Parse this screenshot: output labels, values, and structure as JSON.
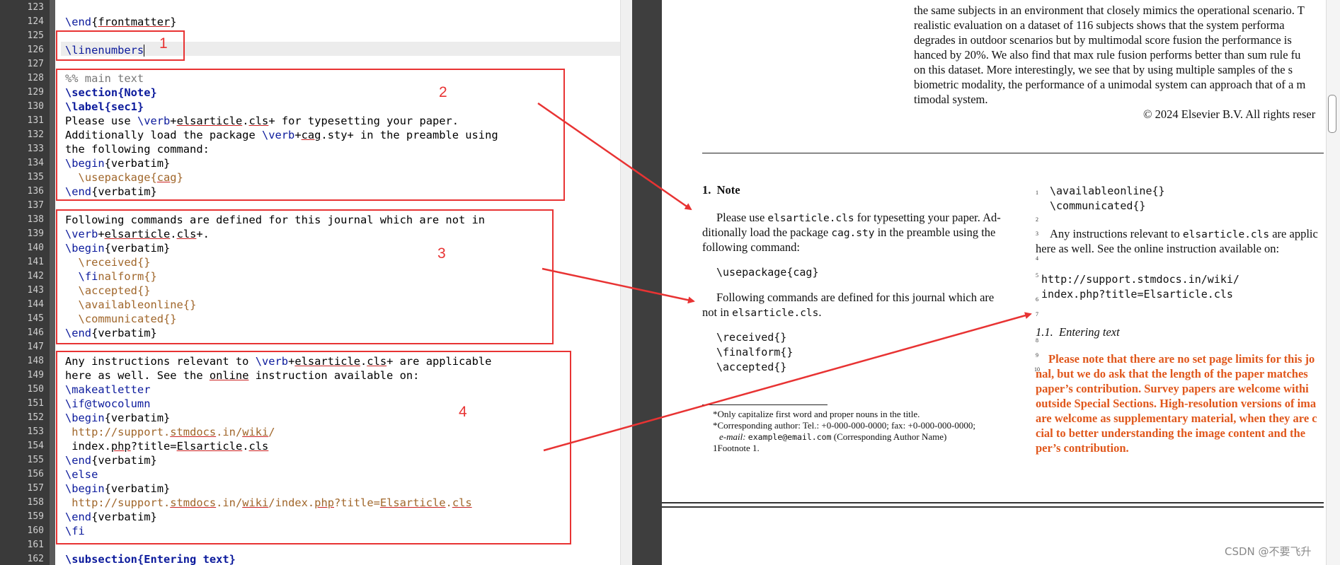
{
  "editor": {
    "lines": [
      {
        "no": "123",
        "code": ""
      },
      {
        "no": "124",
        "code": "\\end{frontmatter}"
      },
      {
        "no": "125",
        "code": ""
      },
      {
        "no": "126",
        "code": "\\linenumbers"
      },
      {
        "no": "127",
        "code": ""
      },
      {
        "no": "128",
        "code": "%% main text"
      },
      {
        "no": "129",
        "code": "\\section{Note}"
      },
      {
        "no": "130",
        "code": "\\label{sec1}"
      },
      {
        "no": "131",
        "code": "Please use \\verb+elsarticle.cls+ for typesetting your paper."
      },
      {
        "no": "132",
        "code": "Additionally load the package \\verb+cag.sty+ in the preamble using"
      },
      {
        "no": "133",
        "code": "the following command:"
      },
      {
        "no": "134",
        "code": "\\begin{verbatim}"
      },
      {
        "no": "135",
        "code": "  \\usepackage{cag}"
      },
      {
        "no": "136",
        "code": "\\end{verbatim}"
      },
      {
        "no": "137",
        "code": ""
      },
      {
        "no": "138",
        "code": "Following commands are defined for this journal which are not in"
      },
      {
        "no": "139",
        "code": "\\verb+elsarticle.cls+."
      },
      {
        "no": "140",
        "code": "\\begin{verbatim}"
      },
      {
        "no": "141",
        "code": "  \\received{}"
      },
      {
        "no": "142",
        "code": "  \\finalform{}"
      },
      {
        "no": "143",
        "code": "  \\accepted{}"
      },
      {
        "no": "144",
        "code": "  \\availableonline{}"
      },
      {
        "no": "145",
        "code": "  \\communicated{}"
      },
      {
        "no": "146",
        "code": "\\end{verbatim}"
      },
      {
        "no": "147",
        "code": ""
      },
      {
        "no": "148",
        "code": "Any instructions relevant to \\verb+elsarticle.cls+ are applicable"
      },
      {
        "no": "149",
        "code": "here as well. See the online instruction available on:"
      },
      {
        "no": "150",
        "code": "\\makeatletter"
      },
      {
        "no": "151",
        "code": "\\if@twocolumn"
      },
      {
        "no": "152",
        "code": "\\begin{verbatim}"
      },
      {
        "no": "153",
        "code": " http://support.stmdocs.in/wiki/"
      },
      {
        "no": "154",
        "code": " index.php?title=Elsarticle.cls"
      },
      {
        "no": "155",
        "code": "\\end{verbatim}"
      },
      {
        "no": "156",
        "code": "\\else"
      },
      {
        "no": "157",
        "code": "\\begin{verbatim}"
      },
      {
        "no": "158",
        "code": " http://support.stmdocs.in/wiki/index.php?title=Elsarticle.cls"
      },
      {
        "no": "159",
        "code": "\\end{verbatim}"
      },
      {
        "no": "160",
        "code": "\\fi"
      },
      {
        "no": "161",
        "code": ""
      },
      {
        "no": "162",
        "code": "\\subsection{Entering text}"
      }
    ]
  },
  "pdf": {
    "abstract_lines": [
      "the same subjects in an environment that closely mimics the operational scenario. T",
      "realistic evaluation on a dataset of 116 subjects shows that the system performa",
      "degrades in outdoor scenarios but by multimodal score fusion the performance is",
      "hanced by 20%. We also find that max rule fusion performs better than sum rule fu",
      "on this dataset. More interestingly, we see that by using multiple samples of the s",
      "biometric modality, the performance of a unimodal system can approach that of a m",
      "timodal system."
    ],
    "copyright": "© 2024 Elsevier B.V. All rights reser",
    "left_col": {
      "heading": "1.  Note",
      "p1": [
        "Please use ",
        "elsarticle.cls",
        " for typesetting your paper. Ad-"
      ],
      "p1_line2": [
        "ditionally load the package ",
        "cag.sty",
        " in the preamble using the"
      ],
      "p1_line3": "following command:",
      "usepackage": "\\usepackage{cag}",
      "p2_line1": "Following commands are defined for this journal which are",
      "p2_line2": [
        "not in ",
        "elsarticle.cls",
        "."
      ],
      "verb": [
        "\\received{}",
        "\\finalform{}",
        "\\accepted{}"
      ],
      "footnotes": [
        "*Only capitalize first word and proper nouns in the title.",
        "*Corresponding author: Tel.: +0-000-000-0000; fax: +0-000-000-0000;",
        "e-mail: ",
        "example@email.com",
        " (Corresponding Author Name)",
        "1Footnote 1."
      ]
    },
    "right_col": {
      "verb1": "\\availableonline{}",
      "verb2": "\\communicated{}",
      "p3_line1": [
        "Any instructions relevant to ",
        "elsarticle.cls",
        " are applic"
      ],
      "p3_line2": "here as well. See the online instruction available on:",
      "url1": "http://support.stmdocs.in/wiki/",
      "url2": "index.php?title=Elsarticle.cls",
      "subsection": "1.1.  Entering text",
      "orange_lines": [
        "Please note that there are no set page limits for this jo",
        "nal, but we do ask that the length of the paper matches",
        "paper’s contribution. Survey papers are welcome withi",
        "outside Special Sections. High-resolution versions of ima",
        "are welcome as supplementary material, when they are c",
        "cial to better understanding the image content and the",
        "per’s contribution."
      ],
      "line_numbers": [
        "1",
        "2",
        "3",
        "4",
        "5",
        "6",
        "7",
        "8",
        "9",
        "10"
      ]
    }
  },
  "annotations": {
    "labels": [
      "1",
      "2",
      "3",
      "4"
    ],
    "color": "#e83333"
  },
  "watermark": "CSDN @不要飞升"
}
